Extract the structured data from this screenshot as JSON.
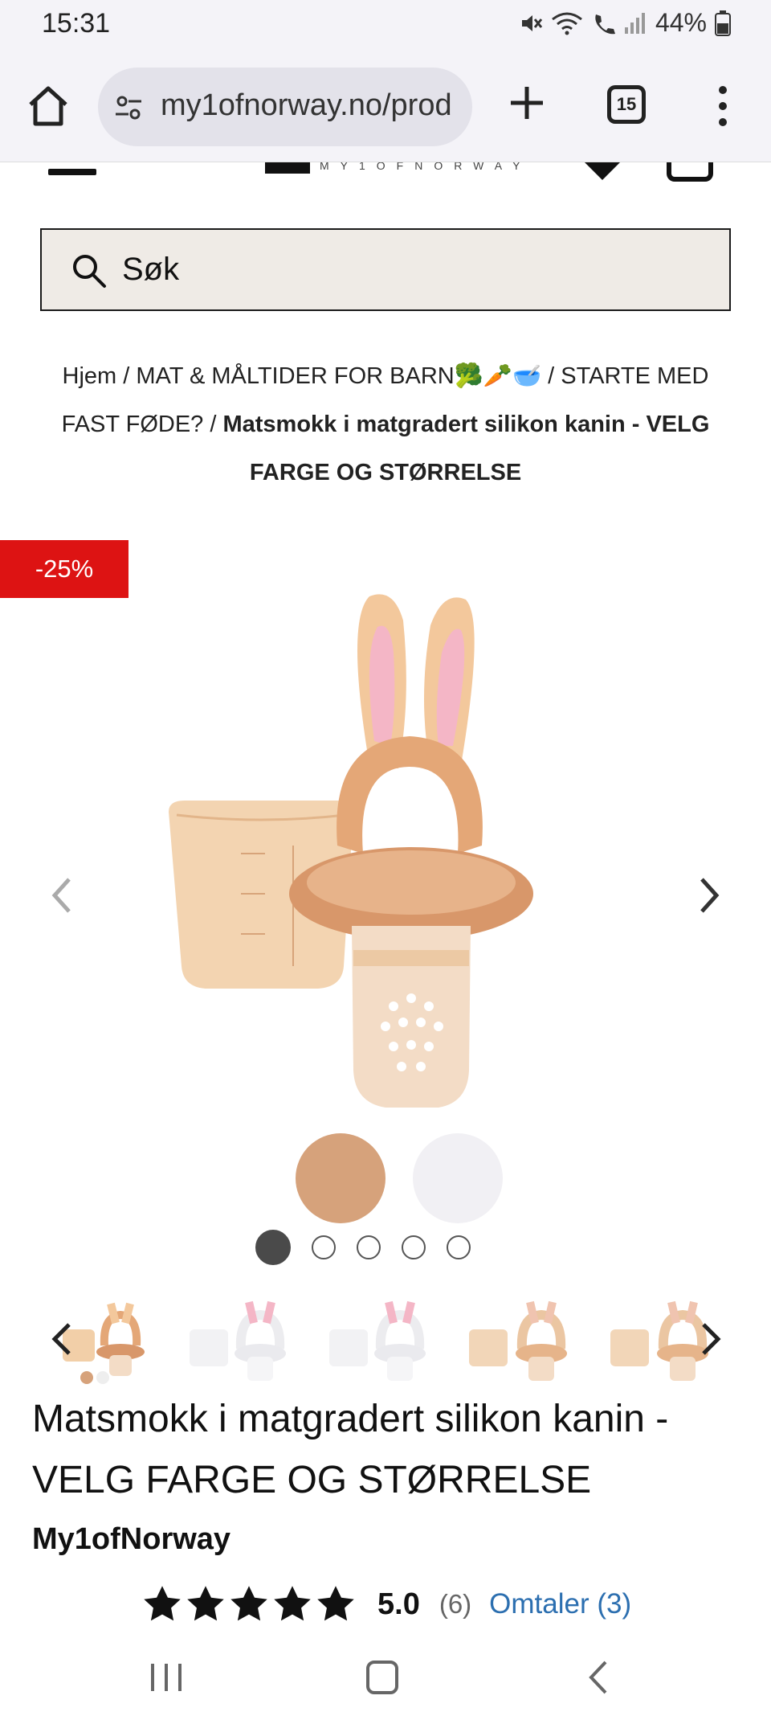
{
  "status_bar": {
    "time": "15:31",
    "battery": "44%"
  },
  "browser": {
    "url": "my1ofnorway.no/prod",
    "tab_count": "15"
  },
  "header": {
    "logo_text": "MY1OFNORWAY"
  },
  "search": {
    "placeholder": "Søk"
  },
  "breadcrumb": {
    "home": "Hjem",
    "sep": " / ",
    "category": "MAT & MÅLTIDER FOR BARN🥦🥕🥣",
    "subcategory": "STARTE MED FAST FØDE?",
    "current": "Matsmokk i matgradert silikon kanin - VELG FARGE OG STØRRELSE"
  },
  "product": {
    "discount": "-25%",
    "title": "Matsmokk i matgradert silikon kanin - VELG FARGE OG STØRRELSE",
    "brand": "My1ofNorway",
    "rating": "5.0",
    "rating_count": "(6)",
    "reviews_link": "Omtaler (3)",
    "stars": 5,
    "swatch_colors": [
      "#d6a27b",
      "#f1f0f4"
    ],
    "gallery_pages": 5,
    "gallery_active": 1
  },
  "icons": {
    "home": "home-icon",
    "site_settings": "tune-icon",
    "new_tab": "plus-icon",
    "tabs": "tabs-icon",
    "menu": "more-vert-icon",
    "search": "search-icon",
    "prev": "chevron-left-icon",
    "next": "chevron-right-icon",
    "star": "star-icon"
  }
}
